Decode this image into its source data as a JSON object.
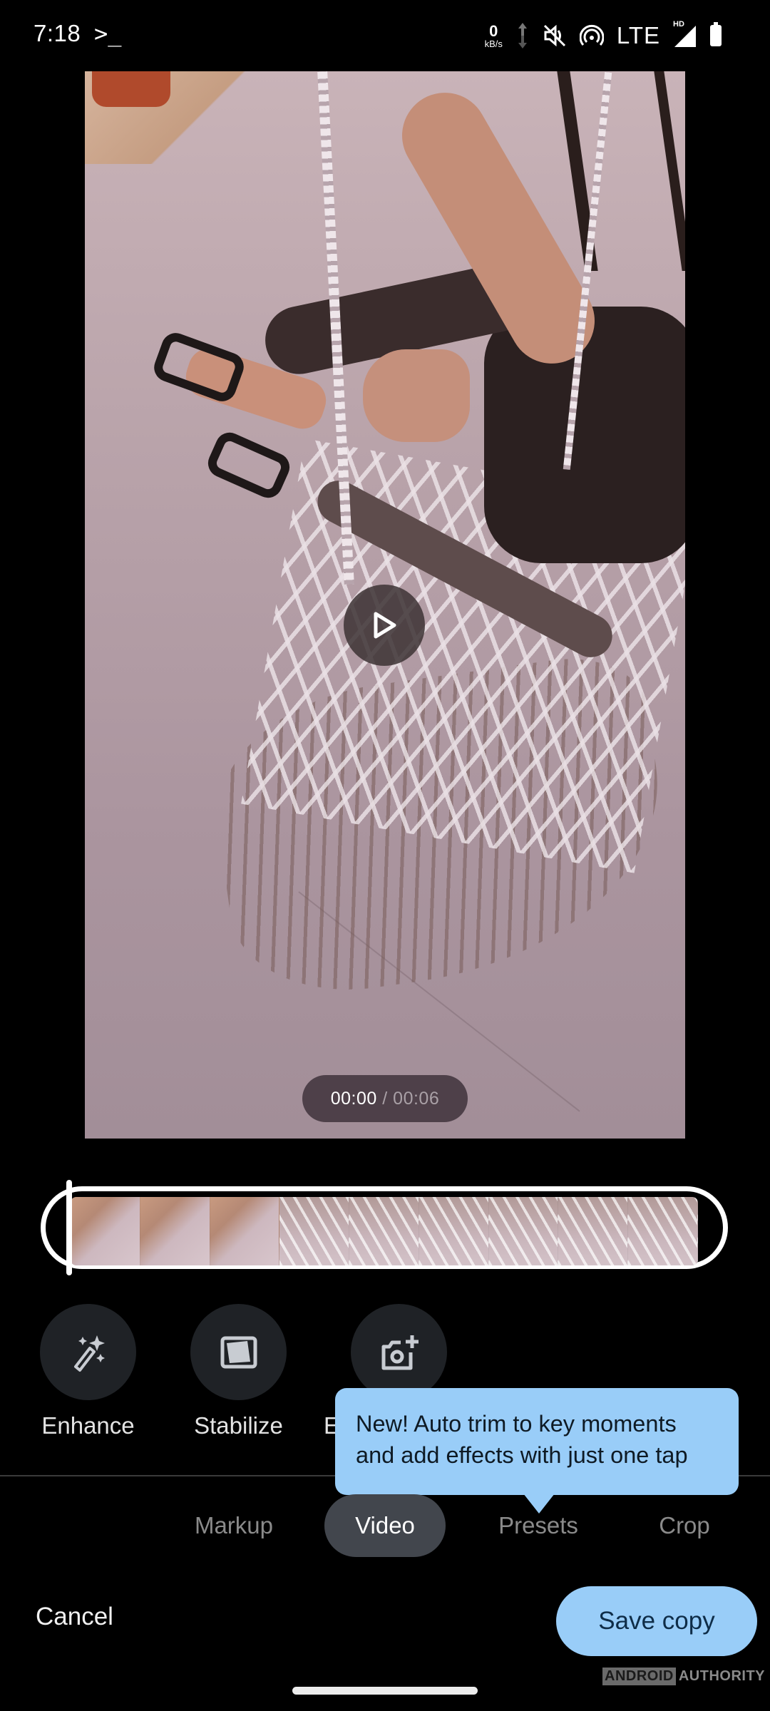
{
  "status_bar": {
    "time": "7:18",
    "terminal_glyph": ">_",
    "net_speed_value": "0",
    "net_speed_unit": "kB/s",
    "network_type": "LTE",
    "hd_badge": "HD",
    "icons": [
      "data-arrows-icon",
      "mute-vibrate-off-icon",
      "hotspot-icon",
      "signal-icon",
      "battery-icon"
    ]
  },
  "video": {
    "current_time": "00:00",
    "separator": "/",
    "total_time": "00:06",
    "play_icon": "play-icon",
    "trim_frame_count": 9
  },
  "tools": [
    {
      "label": "Enhance",
      "icon": "magic-wand-icon"
    },
    {
      "label": "Stabilize",
      "icon": "stabilize-icon"
    },
    {
      "label": "E",
      "icon": "camera-add-icon"
    }
  ],
  "tooltip": {
    "text": "New! Auto trim to key moments and add effects with just one tap"
  },
  "tabs": [
    {
      "label": "Markup",
      "active": false
    },
    {
      "label": "Video",
      "active": true
    },
    {
      "label": "Presets",
      "active": false
    },
    {
      "label": "Crop",
      "active": false
    }
  ],
  "actions": {
    "cancel_label": "Cancel",
    "save_label": "Save copy"
  },
  "watermark": {
    "part1": "ANDROID",
    "part2": "AUTHORITY"
  },
  "colors": {
    "accent": "#99cdf8",
    "active_tab_bg": "#42464d",
    "tool_circle_bg": "#1f2226",
    "background": "#000000"
  }
}
